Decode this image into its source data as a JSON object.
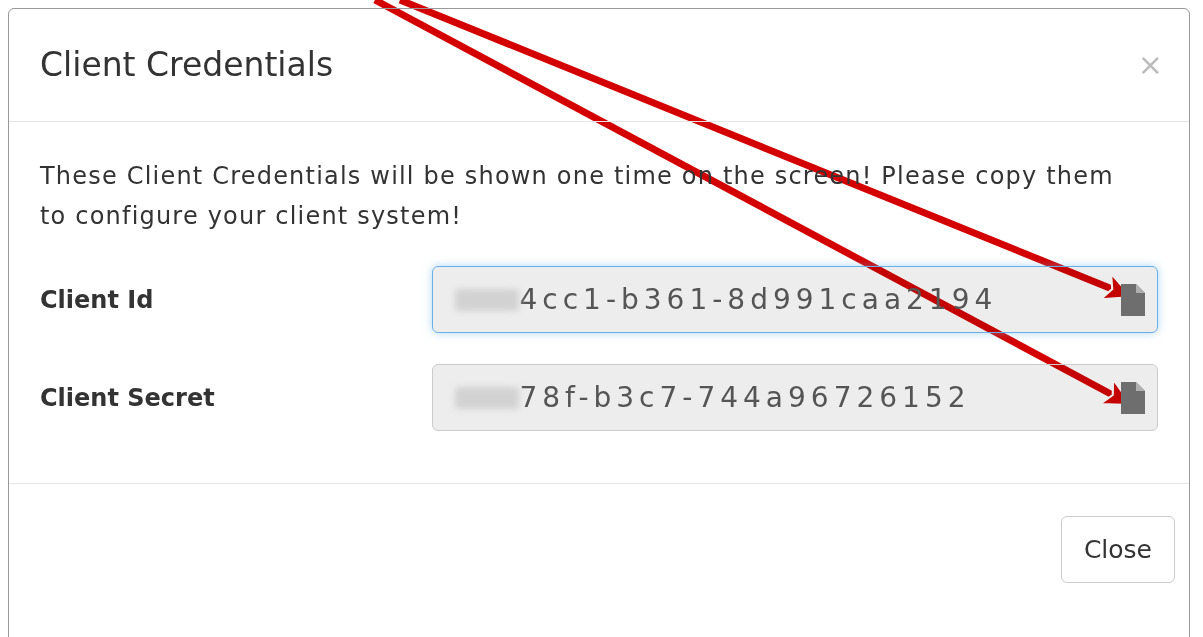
{
  "dialog": {
    "title": "Client Credentials",
    "close_icon": "×",
    "message": "These Client Credentials will be shown one time on the screen! Please copy them to configure your client system!",
    "fields": [
      {
        "label": "Client Id",
        "value": "4cc1-b361-8d991caa2194",
        "focused": true
      },
      {
        "label": "Client Secret",
        "value": "78f-b3c7-744a96726152",
        "focused": false
      }
    ],
    "buttons": [
      "Close"
    ]
  }
}
